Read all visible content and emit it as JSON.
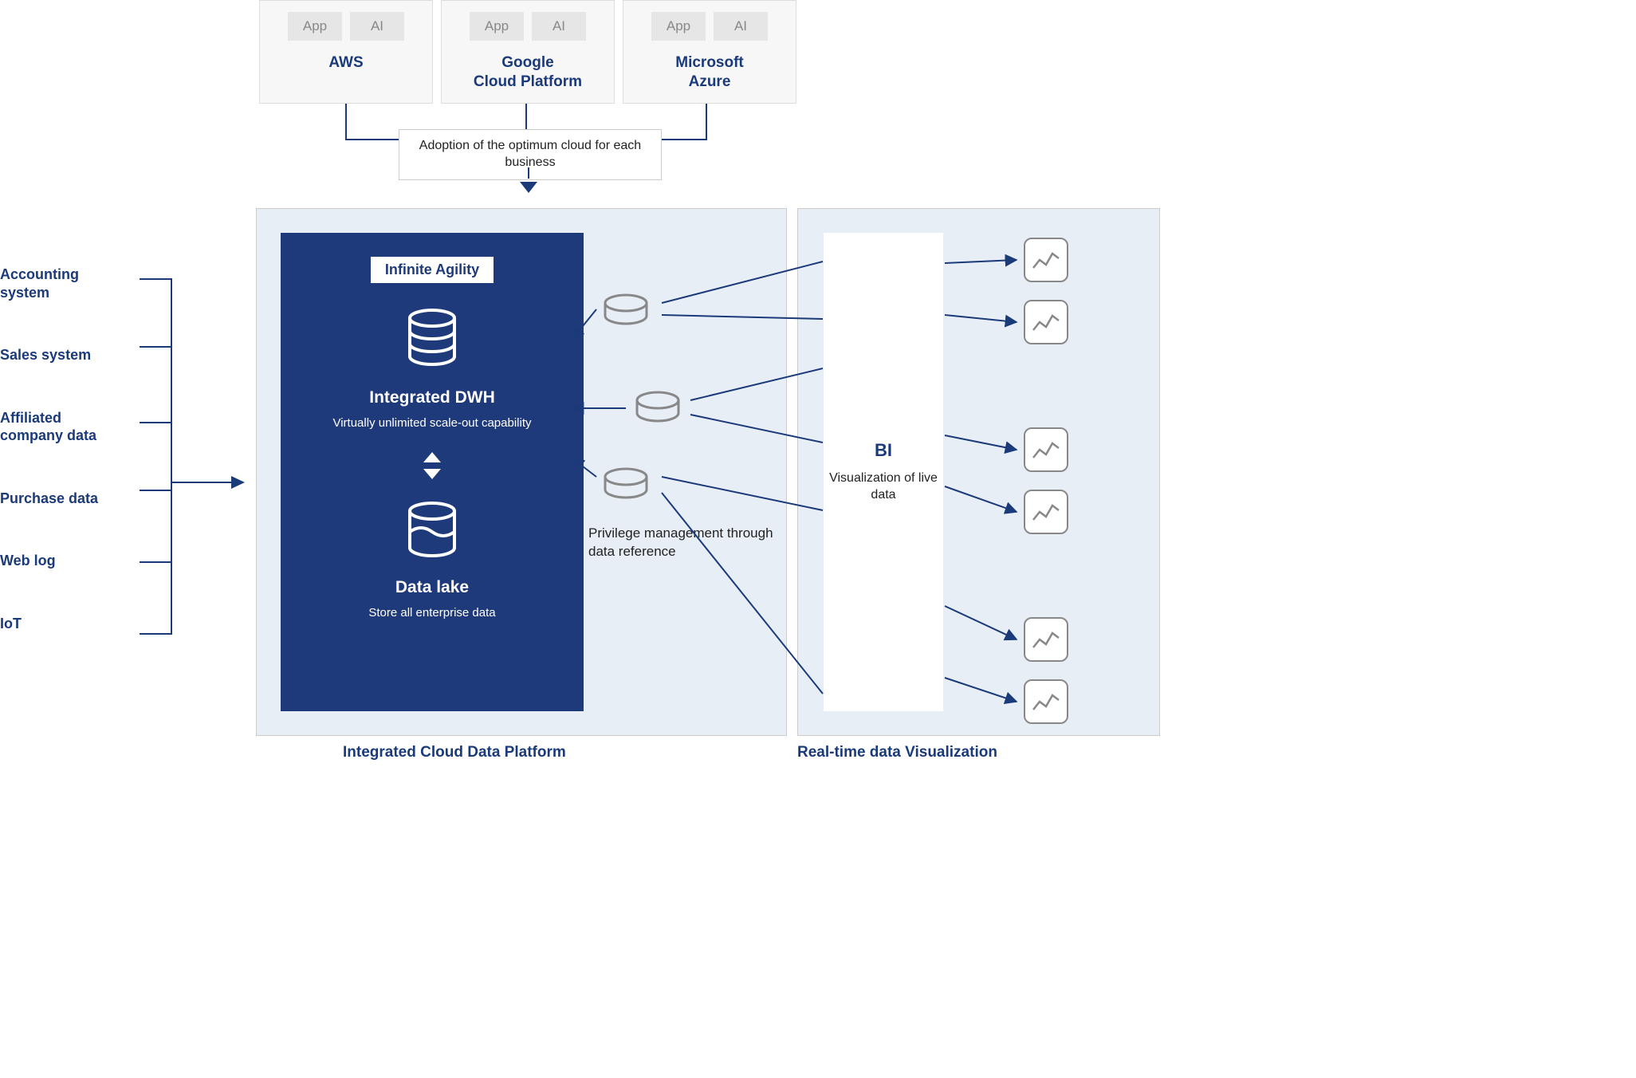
{
  "clouds": [
    {
      "name": "AWS",
      "badges": [
        "App",
        "AI"
      ]
    },
    {
      "name": "Google\nCloud Platform",
      "badges": [
        "App",
        "AI"
      ]
    },
    {
      "name": "Microsoft\nAzure",
      "badges": [
        "App",
        "AI"
      ]
    }
  ],
  "adoption_text": "Adoption of the optimum cloud for each business",
  "sources_list": [
    "Accounting system",
    "Sales system",
    "Affiliated company data",
    "Purchase data",
    "Web log",
    "IoT"
  ],
  "inner_panel": {
    "agility": "Infinite Agility",
    "dwh_title": "Integrated DWH",
    "dwh_sub": "Virtually unlimited scale-out capability",
    "lake_title": "Data lake",
    "lake_sub": "Store all enterprise data"
  },
  "privilege_text": "Privilege management through data reference",
  "platform_label": "Integrated Cloud Data Platform",
  "bi": {
    "title": "BI",
    "sub": "Visualization of live data"
  },
  "viz_label": "Real-time data Visualization"
}
